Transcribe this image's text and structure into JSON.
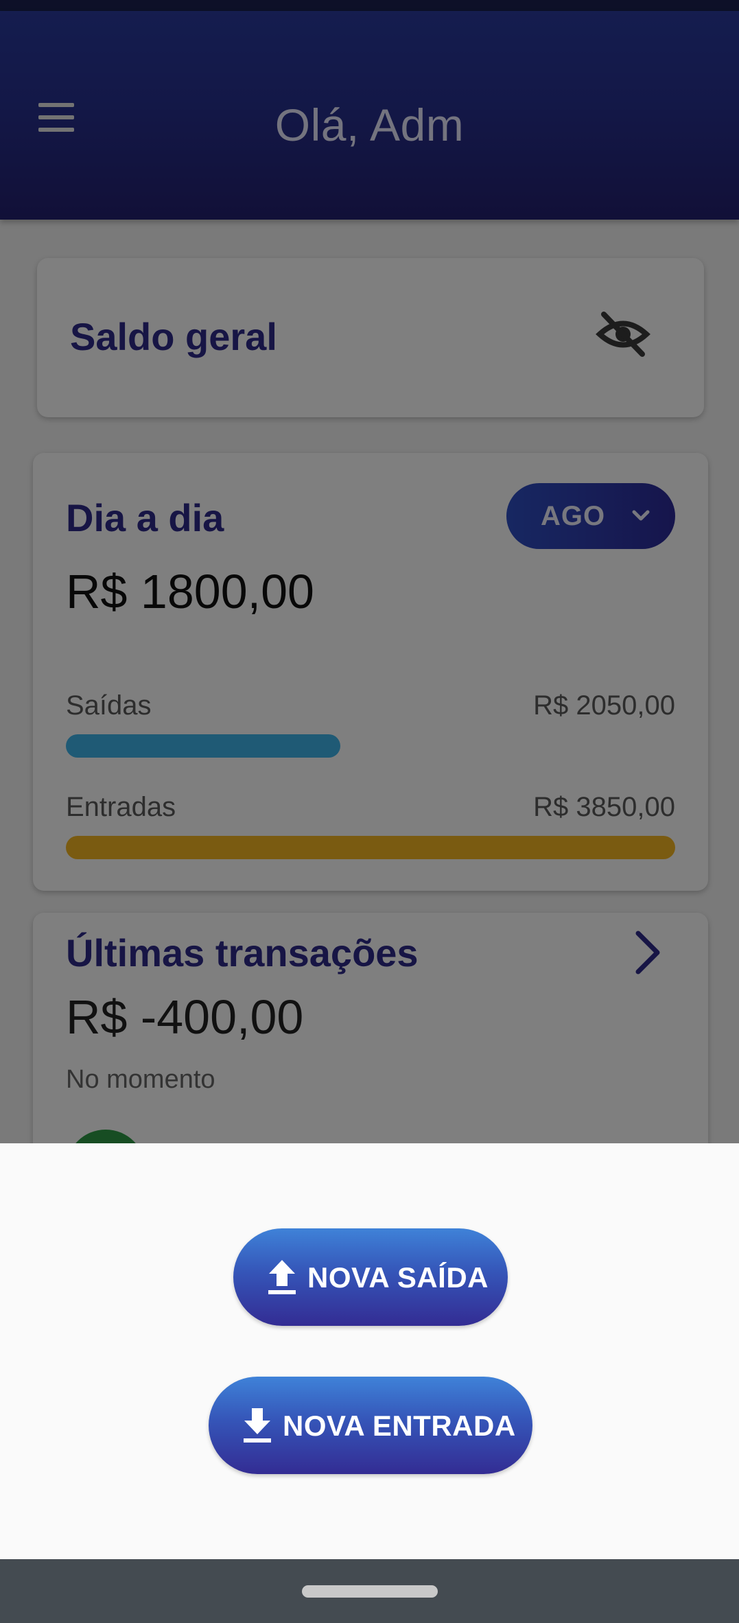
{
  "header": {
    "greeting": "Olá, Adm",
    "menu_icon": "hamburger-menu-icon"
  },
  "saldo_card": {
    "title": "Saldo geral",
    "visibility_icon": "eye-off-icon"
  },
  "dia_card": {
    "title": "Dia a dia",
    "month": "AGO",
    "amount": "R$ 1800,00",
    "saidas": {
      "label": "Saídas",
      "value": "R$ 2050,00",
      "fill_fraction": 0.45,
      "color": "#3fb4ea"
    },
    "entradas": {
      "label": "Entradas",
      "value": "R$ 3850,00",
      "fill_fraction": 1.0,
      "color": "#f5b622"
    }
  },
  "transactions_card": {
    "title": "Últimas transações",
    "amount": "R$ -400,00",
    "time": "No momento",
    "chevron_icon": "chevron-right-icon"
  },
  "sheet": {
    "nova_saida": {
      "label": "NOVA SAÍDA",
      "icon": "upload-icon"
    },
    "nova_entrada": {
      "label": "NOVA ENTRADA",
      "icon": "download-icon"
    }
  },
  "colors": {
    "brand": "#2e2a8a",
    "appbar": "#27308f"
  }
}
